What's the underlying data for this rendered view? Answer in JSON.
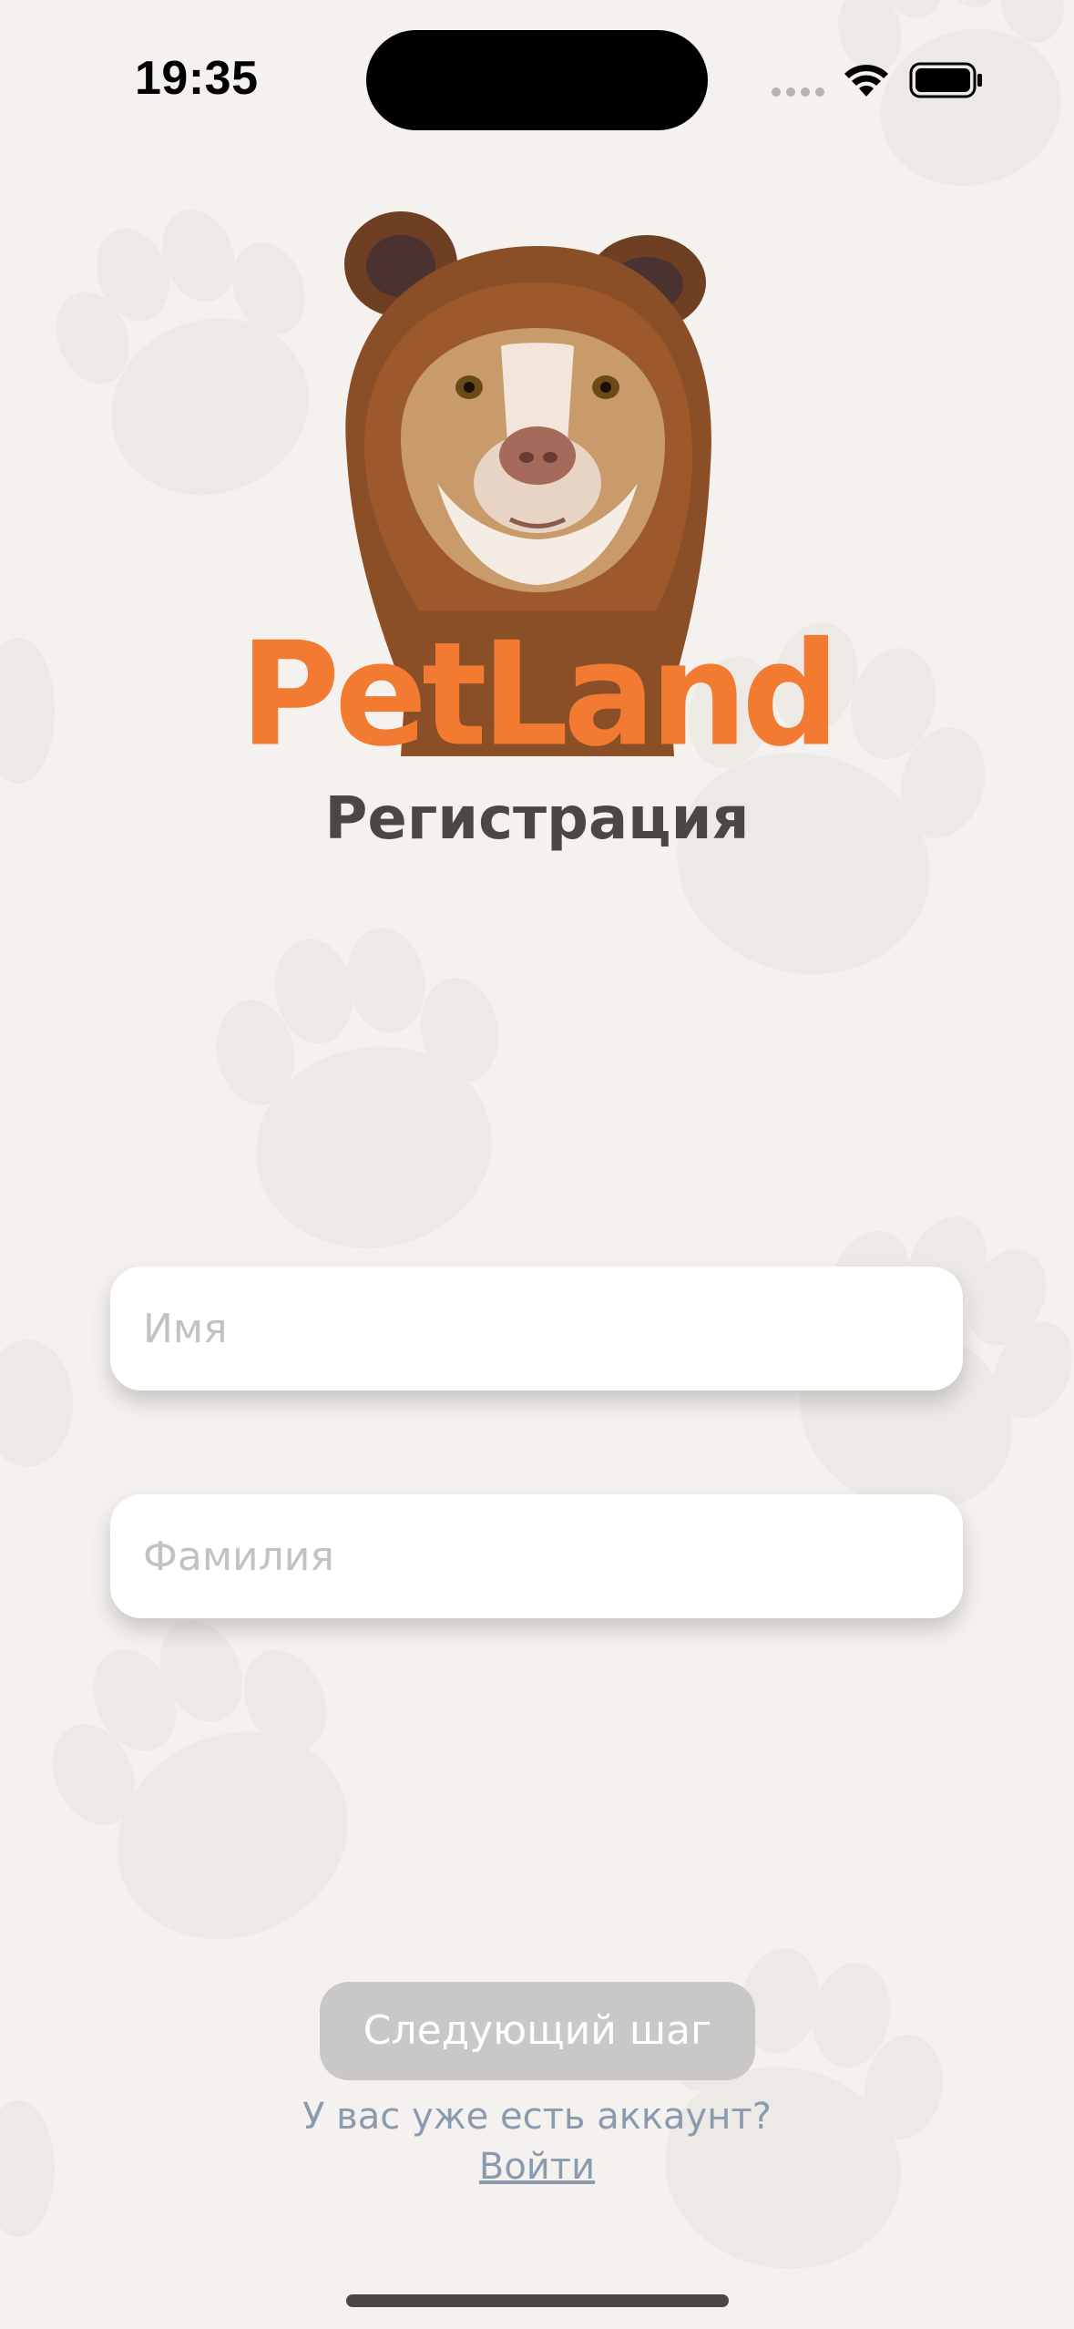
{
  "status_bar": {
    "time": "19:35"
  },
  "brand": {
    "logo_text": "PetLand",
    "logo_color": "#f27a31"
  },
  "page": {
    "title": "Регистрация"
  },
  "form": {
    "first_name": {
      "placeholder": "Имя",
      "value": ""
    },
    "last_name": {
      "placeholder": "Фамилия",
      "value": ""
    },
    "next_label": "Следующий шаг"
  },
  "footer": {
    "prompt": "У вас уже есть аккаунт?",
    "login_label": "Войти"
  },
  "colors": {
    "background": "#f4f1ee",
    "accent": "#f27a31",
    "disabled_button": "#c9c8c6",
    "link": "#8a9bb0"
  },
  "icons": {
    "signal": "cellular-signal-icon",
    "wifi": "wifi-icon",
    "battery": "battery-icon"
  }
}
